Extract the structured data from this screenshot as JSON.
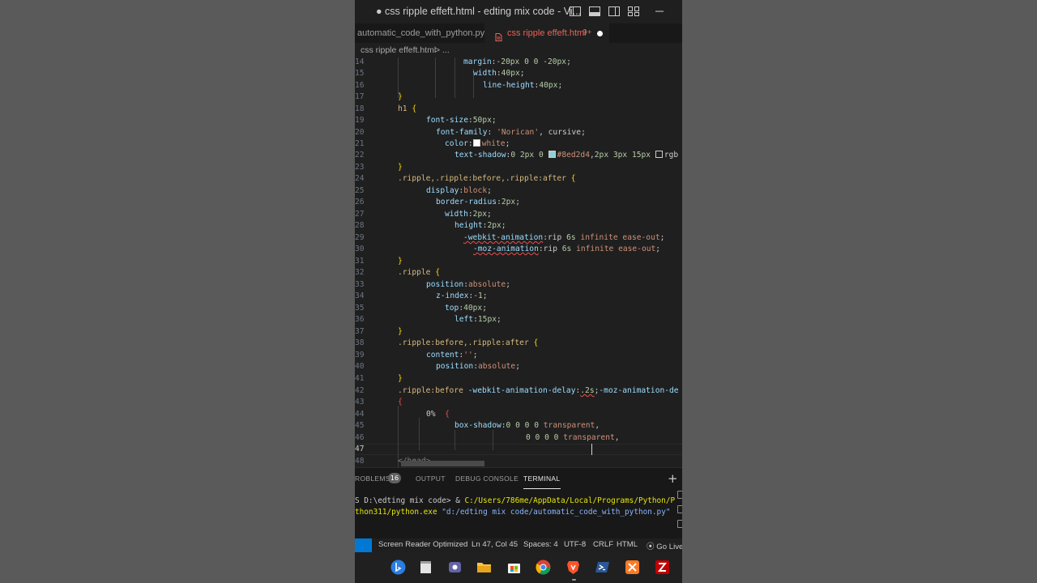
{
  "window": {
    "title": "● css ripple effeft.html - edting mix code - Vi..."
  },
  "tabs": [
    {
      "label": "automatic_code_with_python.py"
    },
    {
      "label": "css ripple effeft.html",
      "badge": "9+"
    }
  ],
  "breadcrumb": {
    "file": "css ripple effeft.html",
    "separator": ">",
    "rest": "..."
  },
  "editor": {
    "line_numbers": [
      "14",
      "15",
      "16",
      "17",
      "18",
      "19",
      "20",
      "21",
      "22",
      "23",
      "24",
      "25",
      "26",
      "27",
      "28",
      "29",
      "30",
      "31",
      "32",
      "33",
      "34",
      "35",
      "36",
      "37",
      "38",
      "39",
      "40",
      "41",
      "42",
      "43",
      "44",
      "45",
      "46",
      "47",
      "48"
    ],
    "active_line": "47"
  },
  "panel": {
    "tabs": {
      "problems": "ROBLEMS",
      "problems_count": "16",
      "output": "OUTPUT",
      "debug": "DEBUG CONSOLE",
      "terminal": "TERMINAL"
    },
    "plus": "+",
    "terminal": {
      "prompt": "S D:\\edting mix code> ",
      "amp": "& ",
      "exe_path": "C:/Users/786me/AppData/Local/Programs/Python/P",
      "exe_cont": "thon311/python.exe",
      "script_arg": "\"d:/edting mix code/automatic_code_with_python.py\""
    }
  },
  "statusbar": {
    "reader": "Screen Reader Optimized",
    "position": "Ln 47, Col 45",
    "spaces": "Spaces: 4",
    "encoding": "UTF-8",
    "eol": "CRLF",
    "language": "HTML",
    "live": "Go Live"
  },
  "taskbar": {
    "icons": [
      "bing-icon",
      "file-explorer-window-icon",
      "teams-icon",
      "folder-icon",
      "store-icon",
      "chrome-icon",
      "brave-icon",
      "powershell-icon",
      "xampp-icon",
      "filezilla-icon"
    ]
  },
  "colors": {
    "accent": "#0078d4",
    "tab_active_text": "#e8645a",
    "selector": "#d7ba7d",
    "property": "#9cdcfe",
    "value": "#ce9178",
    "number": "#b5cea8",
    "swatch_color": "#8ed2d4"
  }
}
